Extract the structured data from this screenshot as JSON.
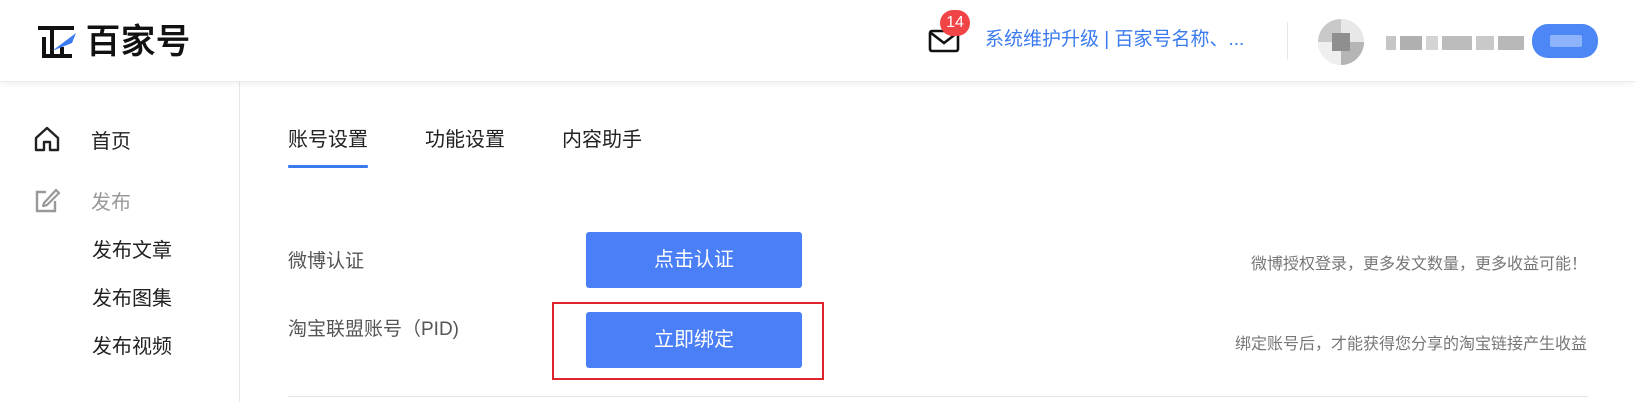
{
  "header": {
    "logo_text": "百家号",
    "mail_count": "14",
    "notice": "系统维护升级 | 百家号名称、..."
  },
  "sidebar": {
    "home_label": "首页",
    "publish_label": "发布",
    "sub_items": [
      "发布文章",
      "发布图集",
      "发布视频"
    ]
  },
  "tabs": [
    "账号设置",
    "功能设置",
    "内容助手"
  ],
  "rows": [
    {
      "label": "微博认证",
      "button": "点击认证",
      "hint": "微博授权登录，更多发文数量，更多收益可能！"
    },
    {
      "label": "淘宝联盟账号（PID)",
      "button": "立即绑定",
      "hint": "绑定账号后，才能获得您分享的淘宝链接产生收益"
    }
  ],
  "colors": {
    "accent": "#3b7bf0",
    "button": "#4b7ff7",
    "badge": "#f04447",
    "highlight": "#e0262d"
  },
  "icons": [
    "logo-icon",
    "mail-icon",
    "home-icon",
    "edit-icon"
  ]
}
